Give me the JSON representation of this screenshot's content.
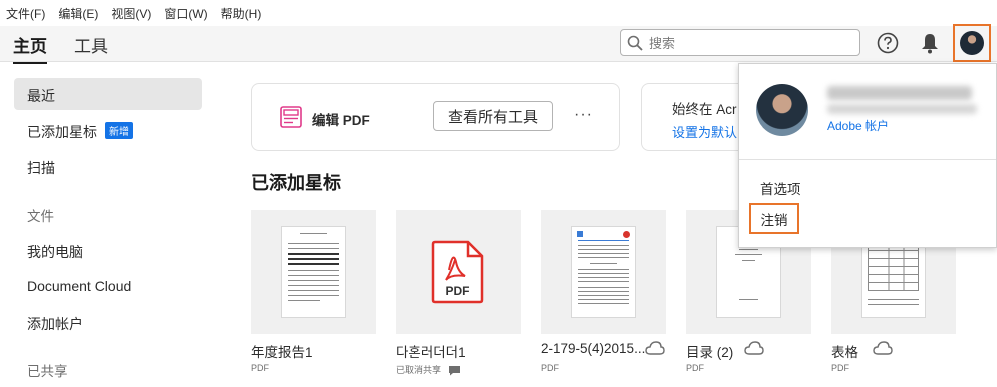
{
  "menubar": [
    "文件(F)",
    "编辑(E)",
    "视图(V)",
    "窗口(W)",
    "帮助(H)"
  ],
  "tabs": {
    "home": "主页",
    "tools": "工具"
  },
  "search": {
    "placeholder": "搜索"
  },
  "sidebar": {
    "recent": "最近",
    "starred": "已添加星标",
    "starred_badge": "新增",
    "scan": "扫描",
    "files_header": "文件",
    "my_computer": "我的电脑",
    "document_cloud": "Document Cloud",
    "add_account": "添加帐户",
    "shared_header": "已共享"
  },
  "cards": {
    "edit_pdf": "编辑 PDF",
    "view_all_tools": "查看所有工具",
    "more": "···",
    "always_open": "始终在 Acr",
    "set_default": "设置为默认"
  },
  "section_title": "已添加星标",
  "files": [
    {
      "name": "年度报告1",
      "type": "PDF",
      "cloud": false
    },
    {
      "name": "다혼러더더1",
      "type": "已取消共享",
      "cloud": false
    },
    {
      "name": "2-179-5(4)2015...",
      "type": "PDF",
      "cloud": true
    },
    {
      "name": "目录 (2)",
      "type": "PDF",
      "cloud": true
    },
    {
      "name": "表格",
      "type": "PDF",
      "cloud": true
    }
  ],
  "dropdown": {
    "account_link": "Adobe 帐户",
    "preferences": "首选项",
    "logout": "注销"
  },
  "colors": {
    "accent": "#1473e6",
    "highlight": "#e8742a",
    "pdf_red": "#e0302a"
  }
}
